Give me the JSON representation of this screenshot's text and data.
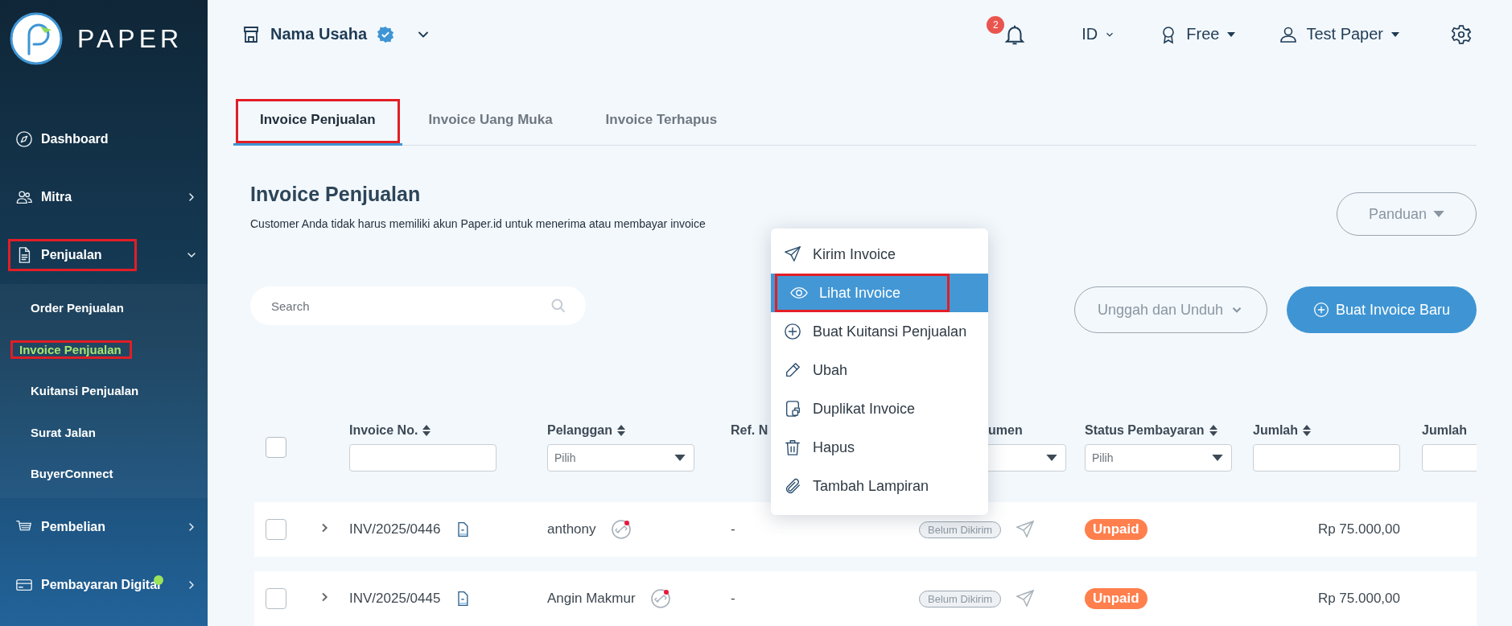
{
  "brand": {
    "name": "PAPER"
  },
  "sidebar": {
    "items": [
      {
        "label": "Dashboard",
        "kind": "link",
        "highlighted": false,
        "dot": false
      },
      {
        "label": "Mitra",
        "kind": "group",
        "expanded": false,
        "highlighted": false,
        "dot": false
      },
      {
        "label": "Penjualan",
        "kind": "group",
        "expanded": true,
        "highlighted": true,
        "dot": false,
        "children": [
          {
            "label": "Order Penjualan",
            "selected": false,
            "highlighted": false
          },
          {
            "label": "Invoice Penjualan",
            "selected": true,
            "highlighted": true
          },
          {
            "label": "Kuitansi Penjualan",
            "selected": false,
            "highlighted": false
          },
          {
            "label": "Surat Jalan",
            "selected": false,
            "highlighted": false
          },
          {
            "label": "BuyerConnect",
            "selected": false,
            "highlighted": false
          }
        ]
      },
      {
        "label": "Pembelian",
        "kind": "group",
        "expanded": false,
        "highlighted": false,
        "dot": false
      },
      {
        "label": "Pembayaran Digital",
        "kind": "group",
        "expanded": false,
        "highlighted": false,
        "dot": true
      }
    ]
  },
  "topbar": {
    "business": {
      "name": "Nama Usaha",
      "verified": true
    },
    "notifications": {
      "count": "2"
    },
    "language": "ID",
    "plan": "Free",
    "user": "Test Paper"
  },
  "tabs": [
    {
      "label": "Invoice Penjualan",
      "selected": true,
      "highlighted": true
    },
    {
      "label": "Invoice Uang Muka",
      "selected": false,
      "highlighted": false
    },
    {
      "label": "Invoice Terhapus",
      "selected": false,
      "highlighted": false
    }
  ],
  "page": {
    "title": "Invoice Penjualan",
    "subtitle": "Customer Anda tidak harus memiliki akun Paper.id untuk menerima atau membayar invoice",
    "guide_button": "Panduan",
    "search": {
      "placeholder": "Search"
    },
    "import_export_button": "Unggah dan Unduh",
    "create_button": "Buat Invoice Baru"
  },
  "table": {
    "select_all_checked": false,
    "columns": [
      {
        "label": "Invoice No.",
        "sortable": true,
        "kind": "input"
      },
      {
        "label": "Pelanggan",
        "sortable": true,
        "kind": "dropdown",
        "placeholder": "Pilih"
      },
      {
        "label": "Ref. N",
        "sortable": false,
        "kind": "plain"
      },
      {
        "label": "umen",
        "sortable": false,
        "kind": "dropdown"
      },
      {
        "label": "Status Pembayaran",
        "sortable": true,
        "kind": "dropdown",
        "placeholder": "Pilih"
      },
      {
        "label": "Jumlah",
        "sortable": true,
        "kind": "input"
      },
      {
        "label": "Jumlah",
        "sortable": false,
        "kind": "input"
      }
    ],
    "rows": [
      {
        "checked": false,
        "invoice_no": "INV/2025/0446",
        "customer": "anthony",
        "ref_no": "-",
        "document_status": "Belum Dikirim",
        "payment_status": "Unpaid",
        "amount": "Rp 75.000,00"
      },
      {
        "checked": false,
        "invoice_no": "INV/2025/0445",
        "customer": "Angin Makmur",
        "ref_no": "-",
        "document_status": "Belum Dikirim",
        "payment_status": "Unpaid",
        "amount": "Rp 75.000,00"
      }
    ]
  },
  "context_menu": {
    "items": [
      {
        "label": "Kirim Invoice",
        "selected": false,
        "highlighted": false
      },
      {
        "label": "Lihat Invoice",
        "selected": true,
        "highlighted": true
      },
      {
        "label": "Buat Kuitansi Penjualan",
        "selected": false,
        "highlighted": false
      },
      {
        "label": "Ubah",
        "selected": false,
        "highlighted": false
      },
      {
        "label": "Duplikat Invoice",
        "selected": false,
        "highlighted": false
      },
      {
        "label": "Hapus",
        "selected": false,
        "highlighted": false
      },
      {
        "label": "Tambah Lampiran",
        "selected": false,
        "highlighted": false
      }
    ]
  }
}
